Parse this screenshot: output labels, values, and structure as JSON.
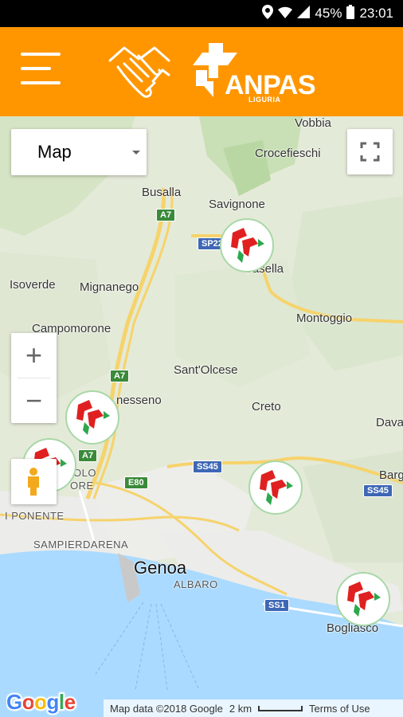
{
  "status_bar": {
    "battery": "45%",
    "time": "23:01"
  },
  "app_bar": {
    "brand": "ANPAS",
    "brand_sub": "LIGURIA"
  },
  "map": {
    "map_type": "Map",
    "zoom_in": "+",
    "zoom_out": "−",
    "places": {
      "vobbia": "Vobbia",
      "crocefieschi": "Crocefieschi",
      "busalla": "Busalla",
      "savignone": "Savignone",
      "casella": "Casella",
      "isoverde": "Isoverde",
      "mignanego": "Mignanego",
      "campomorone": "Campomorone",
      "montoggio": "Montoggio",
      "santolcese": "Sant'Olcese",
      "serra_riccò": "nesseno",
      "creto": "Creto",
      "dava": "Dava",
      "bargagli": "Barg",
      "rivarolo": "OLO",
      "bolzaneto": "ORE",
      "ponente": "I PONENTE",
      "sampierdarena": "SAMPIERDARENA",
      "genoa": "Genoa",
      "albaro": "ALBARO",
      "bogliasco": "Bogliasco"
    },
    "roads": {
      "a7_1": "A7",
      "a7_2": "A7",
      "a7_3": "A7",
      "sp226": "SP22",
      "ss45_1": "SS45",
      "ss45_2": "SS45",
      "e80": "E80",
      "ss1": "SS1"
    },
    "attribution": {
      "google": "Google",
      "map_data": "Map data ©2018 Google",
      "scale": "2 km",
      "terms": "Terms of Use"
    }
  }
}
